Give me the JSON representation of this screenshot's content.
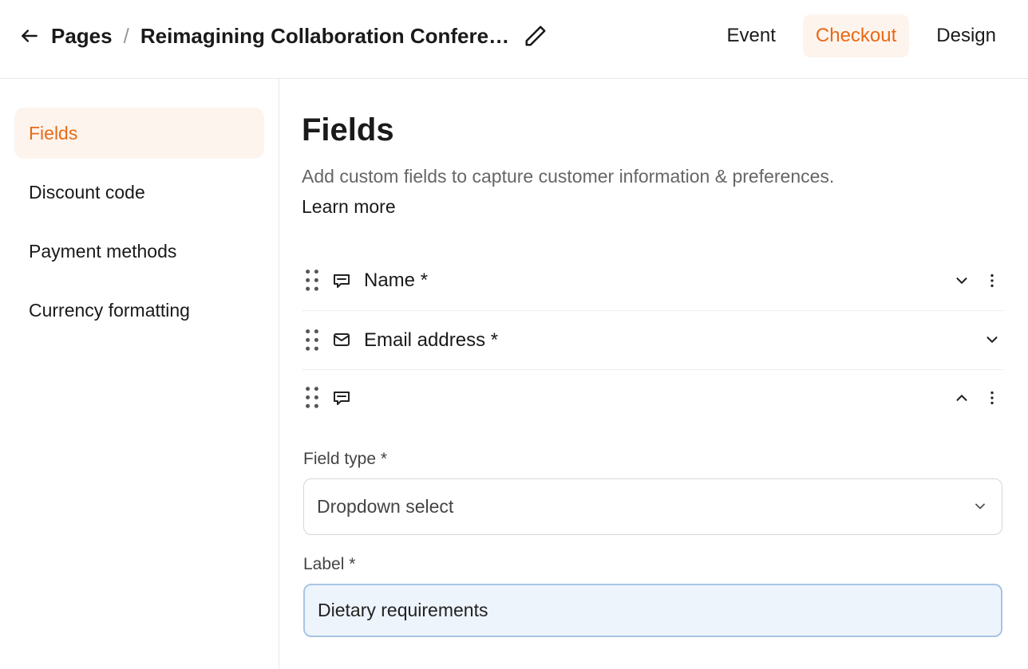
{
  "header": {
    "breadcrumb_root": "Pages",
    "breadcrumb_title": "Reimagining Collaboration Confere…",
    "tabs": [
      {
        "label": "Event",
        "active": false
      },
      {
        "label": "Checkout",
        "active": true
      },
      {
        "label": "Design",
        "active": false
      }
    ]
  },
  "sidebar": {
    "items": [
      {
        "label": "Fields",
        "active": true
      },
      {
        "label": "Discount code",
        "active": false
      },
      {
        "label": "Payment methods",
        "active": false
      },
      {
        "label": "Currency formatting",
        "active": false
      }
    ]
  },
  "page": {
    "title": "Fields",
    "subtitle": "Add custom fields to capture customer information & preferences.",
    "learn_more": "Learn more"
  },
  "fields": [
    {
      "icon": "message",
      "label": "Name *",
      "expanded": false,
      "has_menu": true
    },
    {
      "icon": "mail",
      "label": "Email address *",
      "expanded": false,
      "has_menu": false
    },
    {
      "icon": "message",
      "label": "",
      "expanded": true,
      "has_menu": true
    }
  ],
  "editor": {
    "field_type_label": "Field type *",
    "field_type_value": "Dropdown select",
    "label_label": "Label *",
    "label_value": "Dietary requirements"
  }
}
